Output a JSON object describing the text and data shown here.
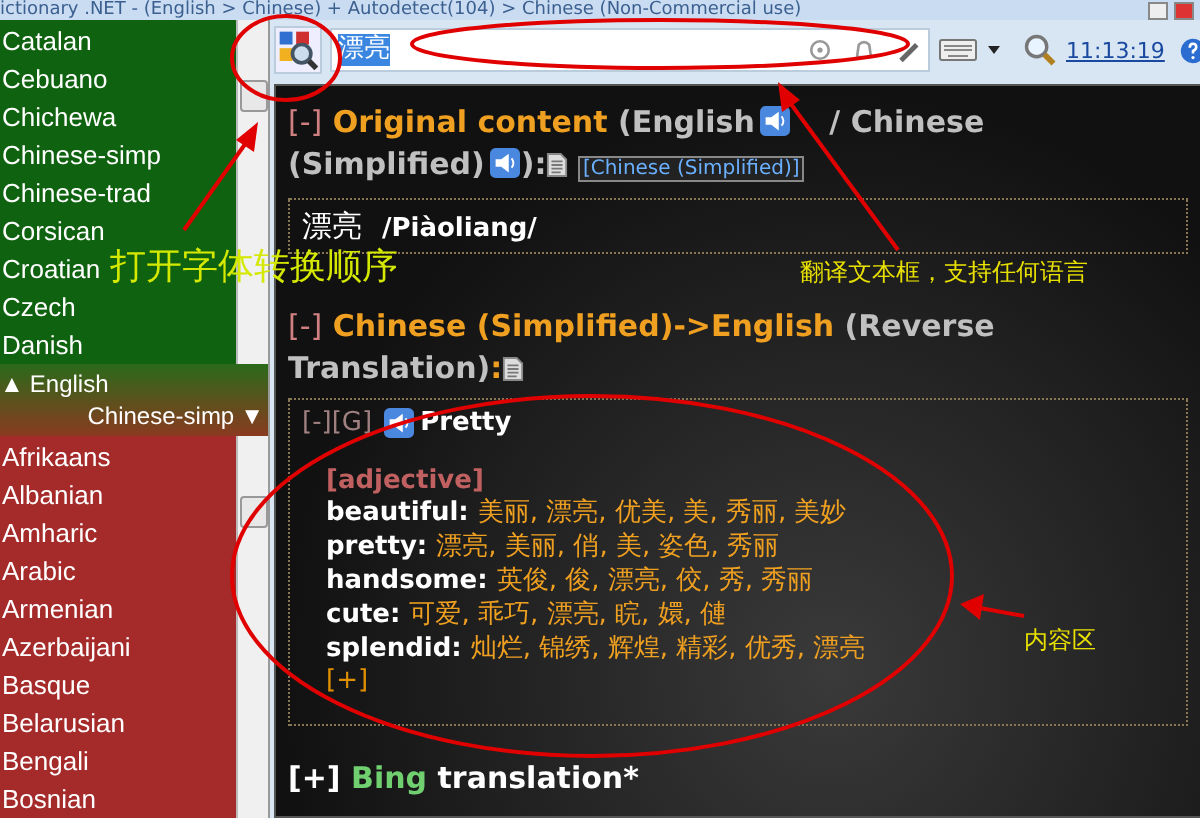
{
  "window": {
    "title": "ictionary .NET - (English > Chinese) + Autodetect(104) > Chinese (Non-Commercial use)"
  },
  "source_languages": {
    "items": [
      {
        "label": "Catalan",
        "selected": false
      },
      {
        "label": "Cebuano",
        "selected": false
      },
      {
        "label": "Chichewa",
        "selected": false
      },
      {
        "label": "Chinese-simp",
        "selected": false
      },
      {
        "label": "Chinese-trad",
        "selected": false
      },
      {
        "label": "Corsican",
        "selected": false
      },
      {
        "label": "Croatian",
        "selected": false
      },
      {
        "label": "Czech",
        "selected": false
      },
      {
        "label": "Danish",
        "selected": false
      }
    ]
  },
  "direction": {
    "from_arrow": "▲",
    "from": "English",
    "to": "Chinese-simp",
    "to_arrow": "▼"
  },
  "target_languages": {
    "items": [
      {
        "label": "Afrikaans",
        "selected": false
      },
      {
        "label": "Albanian",
        "selected": false
      },
      {
        "label": "Amharic",
        "selected": false
      },
      {
        "label": "Arabic",
        "selected": false
      },
      {
        "label": "Armenian",
        "selected": false
      },
      {
        "label": "Azerbaijani",
        "selected": false
      },
      {
        "label": "Basque",
        "selected": false
      },
      {
        "label": "Belarusian",
        "selected": false
      },
      {
        "label": "Bengali",
        "selected": false
      },
      {
        "label": "Bosnian",
        "selected": false
      }
    ]
  },
  "toolbar": {
    "query": "漂亮",
    "time": "11:13:19"
  },
  "original": {
    "toggle": "[-]",
    "title": "Original content",
    "lang1": "(English",
    "lang2": "/ Chinese",
    "lang2_rest": "(Simplified)",
    "close": "):",
    "link": "[Chinese (Simplified)]",
    "word": "漂亮",
    "pinyin": "/Piàoliang/"
  },
  "reverse": {
    "toggle": "[-]",
    "title": "Chinese (Simplified)->English",
    "note": "(Reverse",
    "note_rest": "Translation)",
    "colon": ":"
  },
  "result": {
    "toggle": "[-][G]",
    "headword": "Pretty",
    "part_of_speech": "[adjective]",
    "more": "[+]",
    "entries": [
      {
        "term": "beautiful:",
        "translations": "美丽, 漂亮, 优美, 美, 秀丽, 美妙"
      },
      {
        "term": "pretty:",
        "translations": "漂亮, 美丽, 俏, 美, 姿色, 秀丽"
      },
      {
        "term": "handsome:",
        "translations": "英俊, 俊, 漂亮, 佼, 秀, 秀丽"
      },
      {
        "term": "cute:",
        "translations": "可爱, 乖巧, 漂亮, 睆, 嬛, 僆"
      },
      {
        "term": "splendid:",
        "translations": "灿烂, 锦绣, 辉煌, 精彩, 优秀, 漂亮"
      }
    ]
  },
  "bing": {
    "toggle": "[+]",
    "name": "Bing",
    "label": "translation*"
  },
  "annotations": [
    {
      "text": "打开字体转换顺序",
      "kind": "big"
    },
    {
      "text": "翻译文本框，支持任何语言",
      "kind": "small"
    },
    {
      "text": "内容区",
      "kind": "small"
    }
  ]
}
